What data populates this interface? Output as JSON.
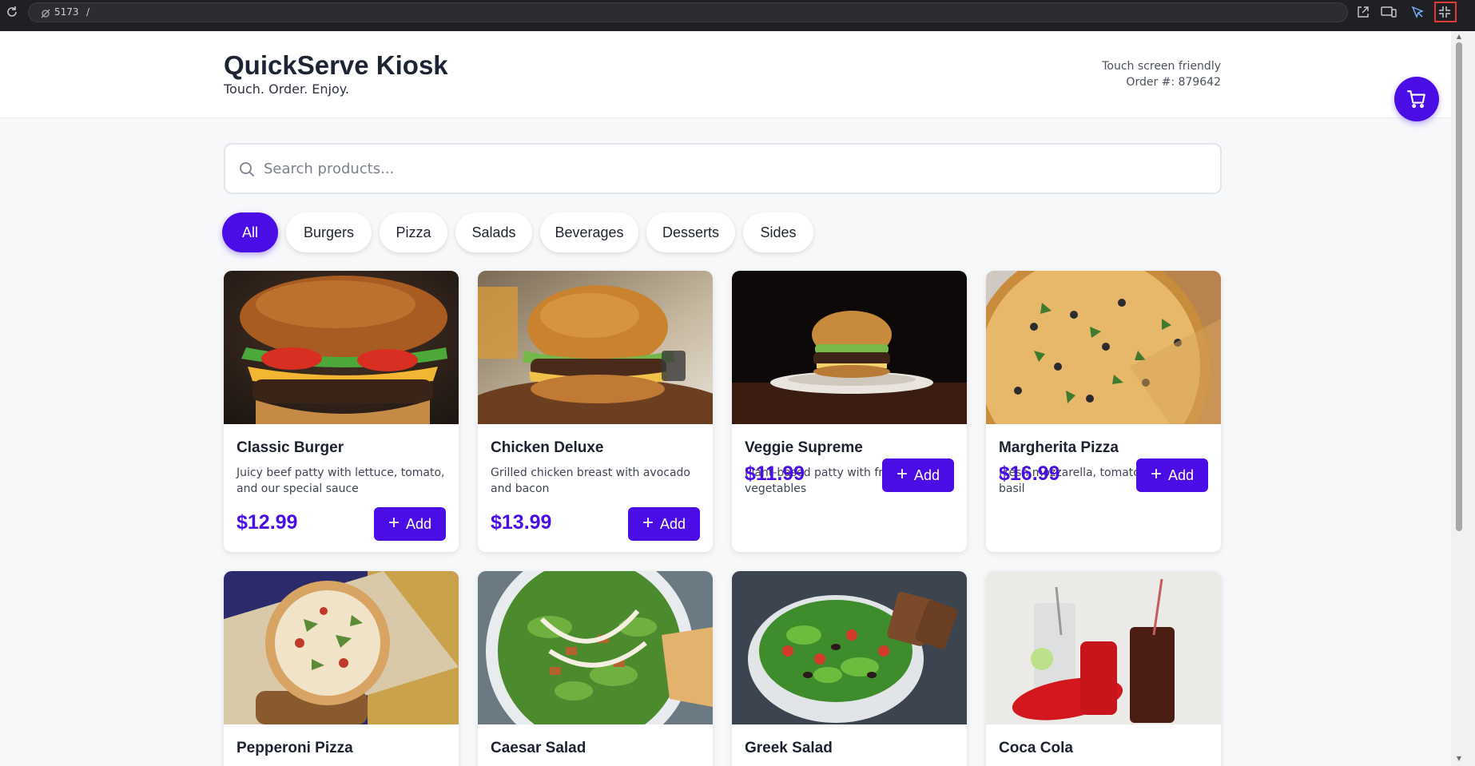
{
  "browser": {
    "port": "5173",
    "path": "/",
    "icons": [
      "reload-icon",
      "not-secure-icon",
      "open-external-icon",
      "device-toolbar-icon",
      "inspect-cursor-icon",
      "exit-fullscreen-icon"
    ]
  },
  "header": {
    "title": "QuickServe Kiosk",
    "subtitle": "Touch. Order. Enjoy.",
    "touch_note": "Touch screen friendly",
    "order_number": "Order #: 879642",
    "cart_icon": "shopping-cart-icon"
  },
  "search": {
    "placeholder": "Search products...",
    "value": "",
    "icon": "search-icon"
  },
  "categories": [
    {
      "label": "All",
      "active": true
    },
    {
      "label": "Burgers",
      "active": false
    },
    {
      "label": "Pizza",
      "active": false
    },
    {
      "label": "Salads",
      "active": false
    },
    {
      "label": "Beverages",
      "active": false
    },
    {
      "label": "Desserts",
      "active": false
    },
    {
      "label": "Sides",
      "active": false
    }
  ],
  "products": [
    {
      "name": "Classic Burger",
      "description": "Juicy beef patty with lettuce, tomato, and our special sauce",
      "price": "$12.99",
      "add_label": "Add",
      "image": "burger-photo"
    },
    {
      "name": "Chicken Deluxe",
      "description": "Grilled chicken breast with avocado and bacon",
      "price": "$13.99",
      "add_label": "Add",
      "image": "chicken-burger-photo"
    },
    {
      "name": "Veggie Supreme",
      "description": "Plant-based patty with fresh vegetables",
      "price": "$11.99",
      "add_label": "Add",
      "image": "veggie-burger-photo"
    },
    {
      "name": "Margherita Pizza",
      "description": "Fresh mozzarella, tomato sauce, and basil",
      "price": "$16.99",
      "add_label": "Add",
      "image": "pizza-photo"
    },
    {
      "name": "Pepperoni Pizza",
      "description": "",
      "price": "",
      "add_label": "",
      "image": "pizza-board-photo"
    },
    {
      "name": "Caesar Salad",
      "description": "",
      "price": "",
      "add_label": "",
      "image": "caesar-salad-photo"
    },
    {
      "name": "Greek Salad",
      "description": "",
      "price": "",
      "add_label": "",
      "image": "greek-salad-photo"
    },
    {
      "name": "Coca Cola",
      "description": "",
      "price": "",
      "add_label": "",
      "image": "cola-photo"
    }
  ],
  "colors": {
    "accent": "#4b0de6",
    "text": "#1d2433",
    "background": "#f7f8fa"
  }
}
